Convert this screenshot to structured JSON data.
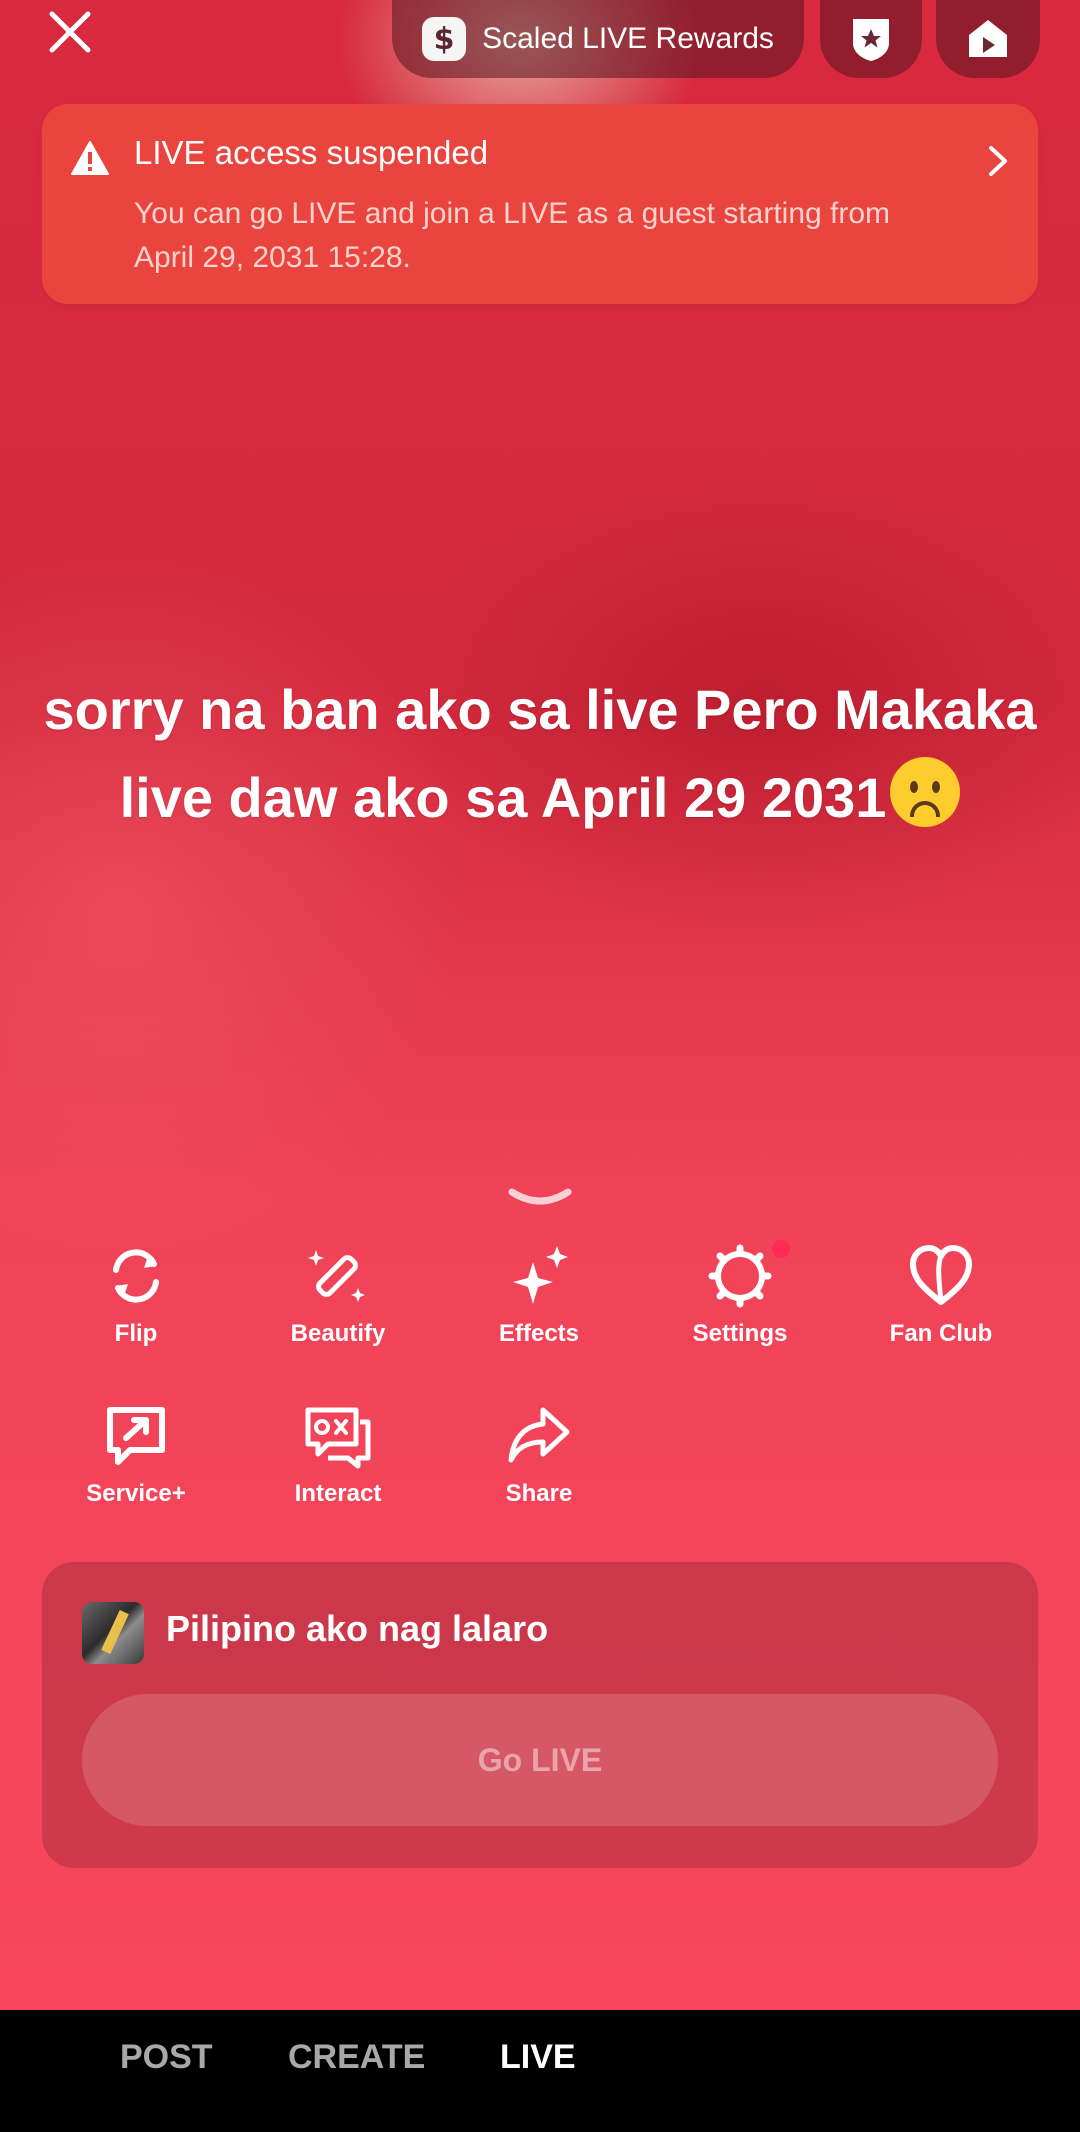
{
  "top": {
    "rewards_label": "Scaled LIVE Rewards",
    "rewards_icon": "dollar-bag-icon",
    "badge_icon": "shield-star-icon",
    "video_icon": "play-video-icon"
  },
  "banner": {
    "title": "LIVE access suspended",
    "description": "You can go LIVE and join a LIVE as a guest starting from April 29, 2031 15:28."
  },
  "caption": {
    "text": "sorry na ban ako sa live Pero Makaka live daw ako sa April 29 2031",
    "emoji": "frowning-face"
  },
  "tools": [
    {
      "label": "Flip",
      "icon": "flip-camera-icon"
    },
    {
      "label": "Beautify",
      "icon": "magic-wand-icon"
    },
    {
      "label": "Effects",
      "icon": "sparkles-icon"
    },
    {
      "label": "Settings",
      "icon": "gear-icon",
      "has_notification_dot": true
    },
    {
      "label": "Fan Club",
      "icon": "heart-icon"
    },
    {
      "label": "Service+",
      "icon": "service-chat-icon"
    },
    {
      "label": "Interact",
      "icon": "game-chat-icon"
    },
    {
      "label": "Share",
      "icon": "share-arrow-icon"
    }
  ],
  "panel": {
    "title": "Pilipino ako nag lalaro",
    "go_live_label": "Go LIVE"
  },
  "bottom_modes": {
    "post": "POST",
    "create": "CREATE",
    "live": "LIVE",
    "active": "LIVE"
  },
  "colors": {
    "accent": "#e5364a",
    "banner": "#e9443e",
    "notification_dot": "#ff2a55"
  }
}
